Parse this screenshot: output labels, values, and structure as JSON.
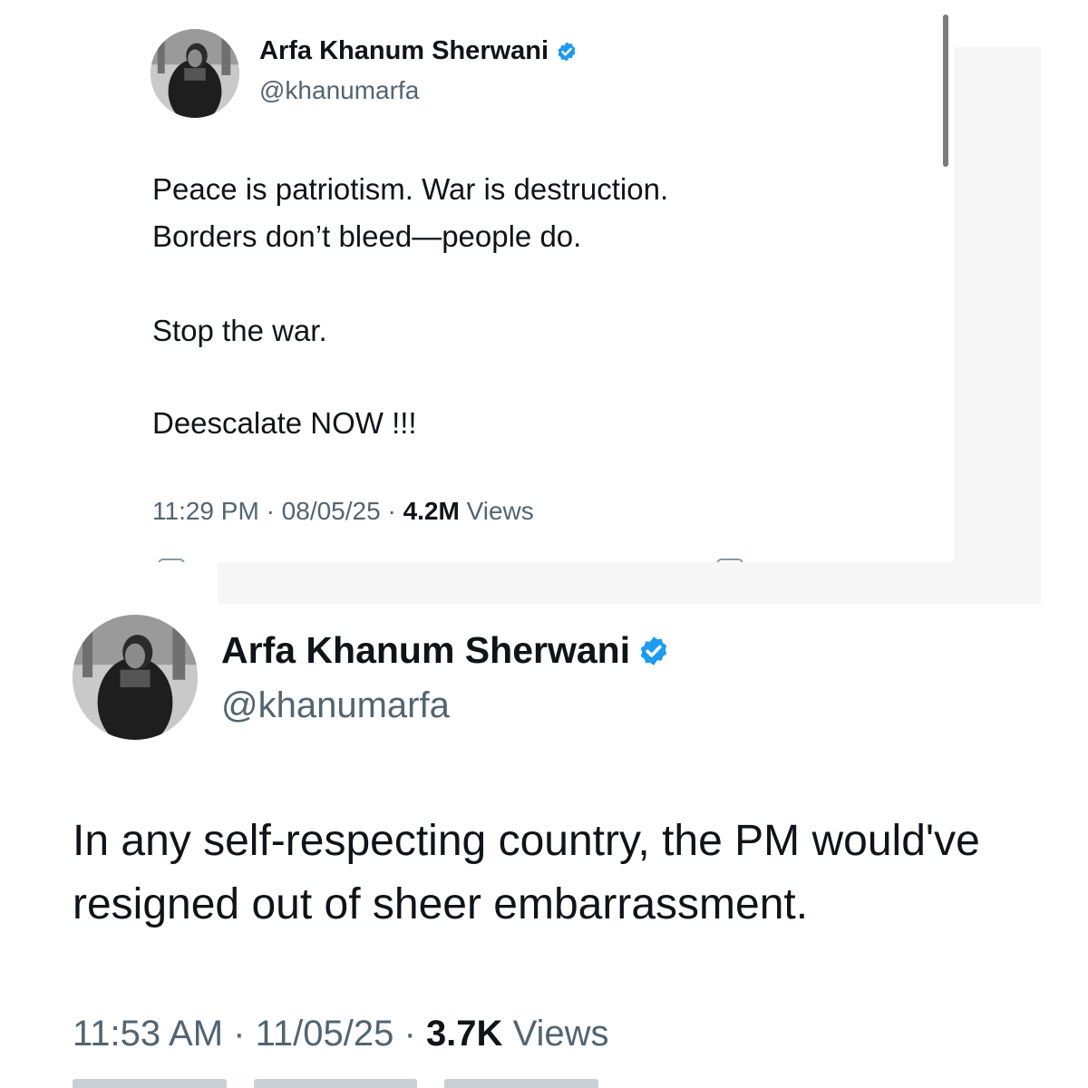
{
  "tweet1": {
    "display_name": "Arfa Khanum Sherwani",
    "handle": "@khanumarfa",
    "verified_icon": "verified-badge-icon",
    "text_lines": [
      "Peace is patriotism. War is destruction.",
      "Borders don’t bleed—people do.",
      "Stop the war.",
      "Deescalate NOW !!!"
    ],
    "time": "11:29 PM",
    "date": "08/05/25",
    "views_count": "4.2M",
    "views_label": "Views",
    "separator": "·"
  },
  "tweet2": {
    "display_name": "Arfa Khanum Sherwani",
    "handle": "@khanumarfa",
    "verified_icon": "verified-badge-icon",
    "text_lines": [
      "In any self-respecting country, the PM would've",
      "resigned out of sheer embarrassment."
    ],
    "time": "11:53 AM",
    "date": "11/05/25",
    "views_count": "3.7K",
    "views_label": "Views",
    "separator": "·"
  },
  "colors": {
    "text_primary": "#0f1419",
    "text_secondary": "#536471",
    "verified_blue": "#1d9bf0"
  }
}
